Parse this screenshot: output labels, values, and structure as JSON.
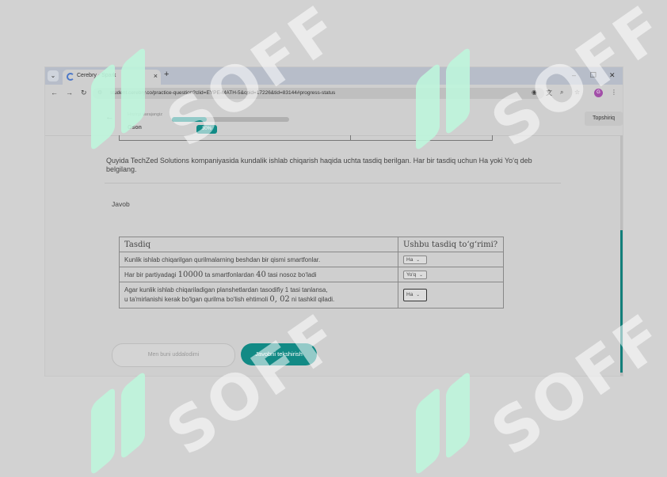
{
  "browser": {
    "tab_title": "Cerebry - Spark",
    "tab_close": "×",
    "new_tab": "+",
    "minimize": "–",
    "restore": "❐",
    "close": "✕",
    "url": "student.cerebry.co/practice-question?clid=EYPE-MATH-5&cpid=17226&tid=83144#progress-status",
    "profile_initial": "G"
  },
  "header": {
    "back": "←",
    "small_label": "Hozirgi darajangiz",
    "level": "Oson",
    "progress": 30,
    "progress_label": "30%",
    "topshiriq": "Topshiriq"
  },
  "question": {
    "text": "Quyida TechZed Solutions kompaniyasida kundalik ishlab chiqarish haqida uchta tasdiq berilgan. Har bir tasdiq uchun Ha yoki Yo‘q deb belgilang."
  },
  "answer_label": "Javob",
  "table": {
    "headers": [
      "Tasdiq",
      "Ushbu tasdiq to‘g‘rimi?"
    ],
    "rows": [
      {
        "pre": "Kunlik ishlab chiqarilgan qurilmalarning beshdan bir qismi smartfonlar.",
        "value": "Ha"
      },
      {
        "pre": "Har bir partiyadagi ",
        "math1": "10000",
        "mid": " ta smartfonlardan ",
        "math2": "40",
        "post": " tasi nosoz bo‘ladi",
        "value": "Yo'q"
      },
      {
        "line1": "Agar kunlik ishlab chiqariladigan planshetlardan tasodifiy 1 tasi tanlansa,",
        "line2_pre": "u ta'mirlanishi kerak bo'lgan qurilma bo'lish ehtimoli ",
        "math": "0, 02",
        "line2_post": " ni tashkil qiladi.",
        "value": "Ha"
      }
    ]
  },
  "buttons": {
    "dont_know": "Men buni uddalodimi",
    "check": "Javobni tekshirish"
  },
  "watermark": "SOFF",
  "colors": {
    "accent": "#118b86",
    "watermark_green": "#bef5dc"
  }
}
